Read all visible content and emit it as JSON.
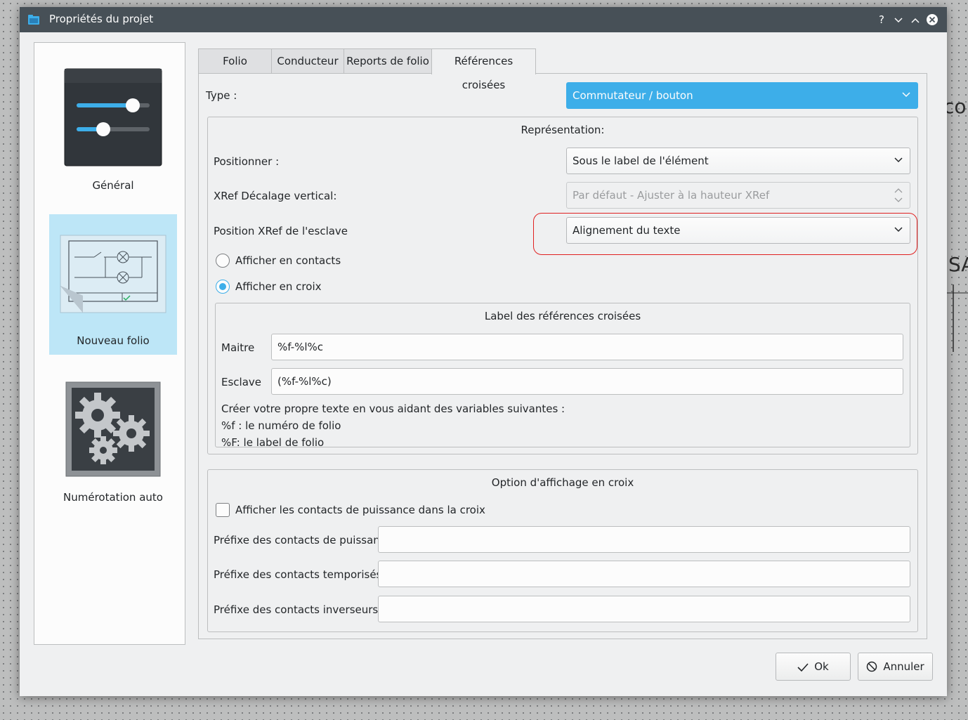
{
  "background": {
    "text_top": "co",
    "text_mid": "SA"
  },
  "window": {
    "title": "Propriétés du projet",
    "buttons": {
      "help": "?",
      "minimize": "⌄",
      "maximize": "⌃",
      "close": "×"
    }
  },
  "sidebar": {
    "items": [
      {
        "label": "Général",
        "icon": "sliders-icon"
      },
      {
        "label": "Nouveau folio",
        "icon": "folio-schematic-icon",
        "selected": true
      },
      {
        "label": "Numérotation auto",
        "icon": "gears-icon"
      }
    ]
  },
  "tabs": [
    {
      "label": "Folio"
    },
    {
      "label": "Conducteur"
    },
    {
      "label": "Reports de folio"
    },
    {
      "label": "Références croisées",
      "active": true
    }
  ],
  "xref": {
    "type_label": "Type :",
    "type_value": "Commutateur / bouton",
    "representation": {
      "title": "Représentation:",
      "position_label": "Positionner :",
      "position_value": "Sous le label de l'élément",
      "offset_label": "XRef Décalage vertical:",
      "offset_value": "Par défaut - Ajuster à la hauteur XRef",
      "slave_label": "Position XRef de l'esclave",
      "slave_value": "Alignement du texte",
      "radio_contacts": "Afficher en contacts",
      "radio_cross": "Afficher en croix",
      "selected_radio": "Afficher en croix"
    },
    "labels": {
      "title": "Label des références croisées",
      "master_label": "Maitre",
      "master_value": "%f-%l%c",
      "slave_label": "Esclave",
      "slave_value": "(%f-%l%c)",
      "help_line1": "Créer votre propre texte en vous aidant des variables suivantes :",
      "help_line2": "%f : le numéro de folio",
      "help_line3": "%F: le label de folio"
    },
    "cross_options": {
      "title": "Option d'affichage en croix",
      "checkbox_label": "Afficher les contacts de puissance dans la croix",
      "checkbox_checked": false,
      "power_prefix_label": "Préfixe des contacts de puissance :",
      "power_prefix_value": "",
      "delay_prefix_label": "Préfixe des contacts temporisés :",
      "delay_prefix_value": "",
      "switch_prefix_label": "Préfixe des contacts inverseurs :",
      "switch_prefix_value": ""
    }
  },
  "footer": {
    "ok_label": "Ok",
    "cancel_label": "Annuler"
  },
  "colors": {
    "accent": "#3daee9",
    "titlebar": "#475057",
    "highlight": "#e02020",
    "selection": "#bde6f7"
  }
}
